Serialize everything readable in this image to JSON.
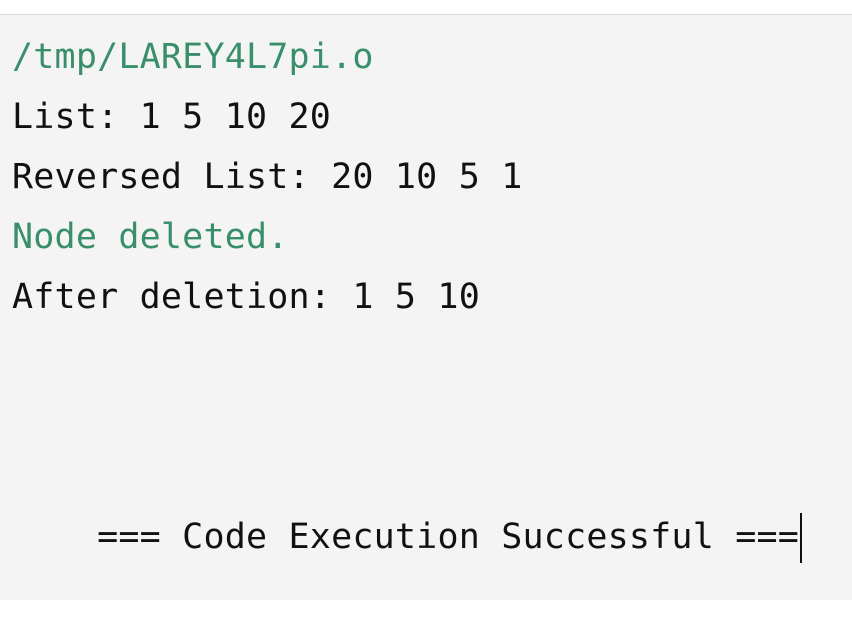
{
  "console": {
    "lines": {
      "path": "/tmp/LAREY4L7pi.o",
      "list": "List: 1 5 10 20",
      "reversed": "Reversed List: 20 10 5 1",
      "deleted": "Node deleted.",
      "after_deletion": "After deletion: 1 5 10",
      "success": "=== Code Execution Successful ==="
    },
    "colors": {
      "background": "#f4f4f4",
      "text": "#111111",
      "accent_green": "#3a8f6b"
    }
  }
}
